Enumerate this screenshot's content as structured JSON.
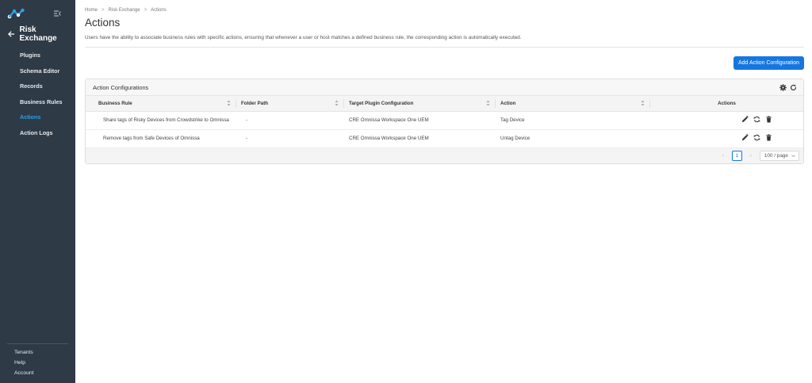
{
  "sidebar": {
    "section_title": "Risk Exchange",
    "items": [
      {
        "label": "Plugins",
        "active": false
      },
      {
        "label": "Schema Editor",
        "active": false
      },
      {
        "label": "Records",
        "active": false
      },
      {
        "label": "Business Rules",
        "active": false
      },
      {
        "label": "Actions",
        "active": true
      },
      {
        "label": "Action Logs",
        "active": false
      }
    ],
    "footer": [
      "Tenants",
      "Help",
      "Account"
    ]
  },
  "breadcrumb": [
    "Home",
    "Risk Exchange",
    "Actions"
  ],
  "breadcrumb_separator": ">",
  "page": {
    "title": "Actions",
    "description": "Users have the ability to associate business rules with specific actions, ensuring that whenever a user or host matches a defined business rule, the corresponding action is automatically executed."
  },
  "toolbar": {
    "add_label": "Add Action Configuration"
  },
  "card": {
    "title": "Action Configurations"
  },
  "table": {
    "columns": [
      "Business Rule",
      "Folder Path",
      "Target Plugin Configuration",
      "Action",
      "Actions"
    ],
    "rows": [
      [
        "Share tags of Risky Devices from Crowdstrike to Omnissa",
        "-",
        "CRE Omnissa Workspace One UEM",
        "Tag Device"
      ],
      [
        "Remove tags from Safe Devices of Omnissa",
        "-",
        "CRE Omnissa Workspace One UEM",
        "Untag Device"
      ]
    ]
  },
  "pagination": {
    "current_page": "1",
    "page_size": "100 / page"
  },
  "colors": {
    "sidebar_bg": "#2e3a46",
    "active_nav": "#2e9fe6",
    "primary": "#1676e0"
  },
  "icons": {
    "logo": "brand-logo-icon",
    "collapse": "collapse-sidebar-icon",
    "back": "arrow-left-icon",
    "settings": "gear-icon",
    "refresh": "refresh-icon",
    "sort": "sort-icon",
    "edit": "pencil-icon",
    "sync": "sync-icon",
    "delete": "trash-icon"
  }
}
